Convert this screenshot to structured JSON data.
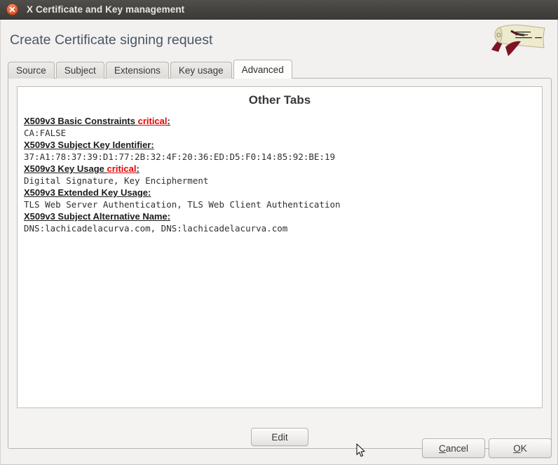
{
  "window": {
    "title": "X Certificate and Key management",
    "close_icon": "close-icon"
  },
  "header": {
    "page_title": "Create Certificate signing request",
    "logo_alt": "xca-certificate-scroll-logo"
  },
  "tabs": [
    {
      "label": "Source",
      "active": false
    },
    {
      "label": "Subject",
      "active": false
    },
    {
      "label": "Extensions",
      "active": false
    },
    {
      "label": "Key usage",
      "active": false
    },
    {
      "label": "Advanced",
      "active": true
    }
  ],
  "panel": {
    "heading": "Other Tabs",
    "extensions": [
      {
        "name": "X509v3 Basic Constraints",
        "critical": "critical",
        "value": "CA:FALSE"
      },
      {
        "name": "X509v3 Subject Key Identifier",
        "critical": "",
        "value": "37:A1:78:37:39:D1:77:2B:32:4F:20:36:ED:D5:F0:14:85:92:BE:19"
      },
      {
        "name": "X509v3 Key Usage",
        "critical": "critical",
        "value": "Digital Signature, Key Encipherment"
      },
      {
        "name": "X509v3 Extended Key Usage",
        "critical": "",
        "value": "TLS Web Server Authentication, TLS Web Client Authentication"
      },
      {
        "name": "X509v3 Subject Alternative Name",
        "critical": "",
        "value": "DNS:lachicadelacurva.com, DNS:lachicadelacurva.com"
      }
    ],
    "edit_button": "Edit"
  },
  "footer": {
    "cancel_label": "Cancel",
    "cancel_accel": "C",
    "ok_label": "OK",
    "ok_accel": "O"
  },
  "colors": {
    "titlebar": "#45433f",
    "close_button": "#e2663a",
    "critical_red": "#e60000",
    "page_title": "#4a5565",
    "dialog_bg": "#f2f1f0",
    "panel_bg": "#f4f3f2",
    "box_bg": "#ffffff"
  }
}
